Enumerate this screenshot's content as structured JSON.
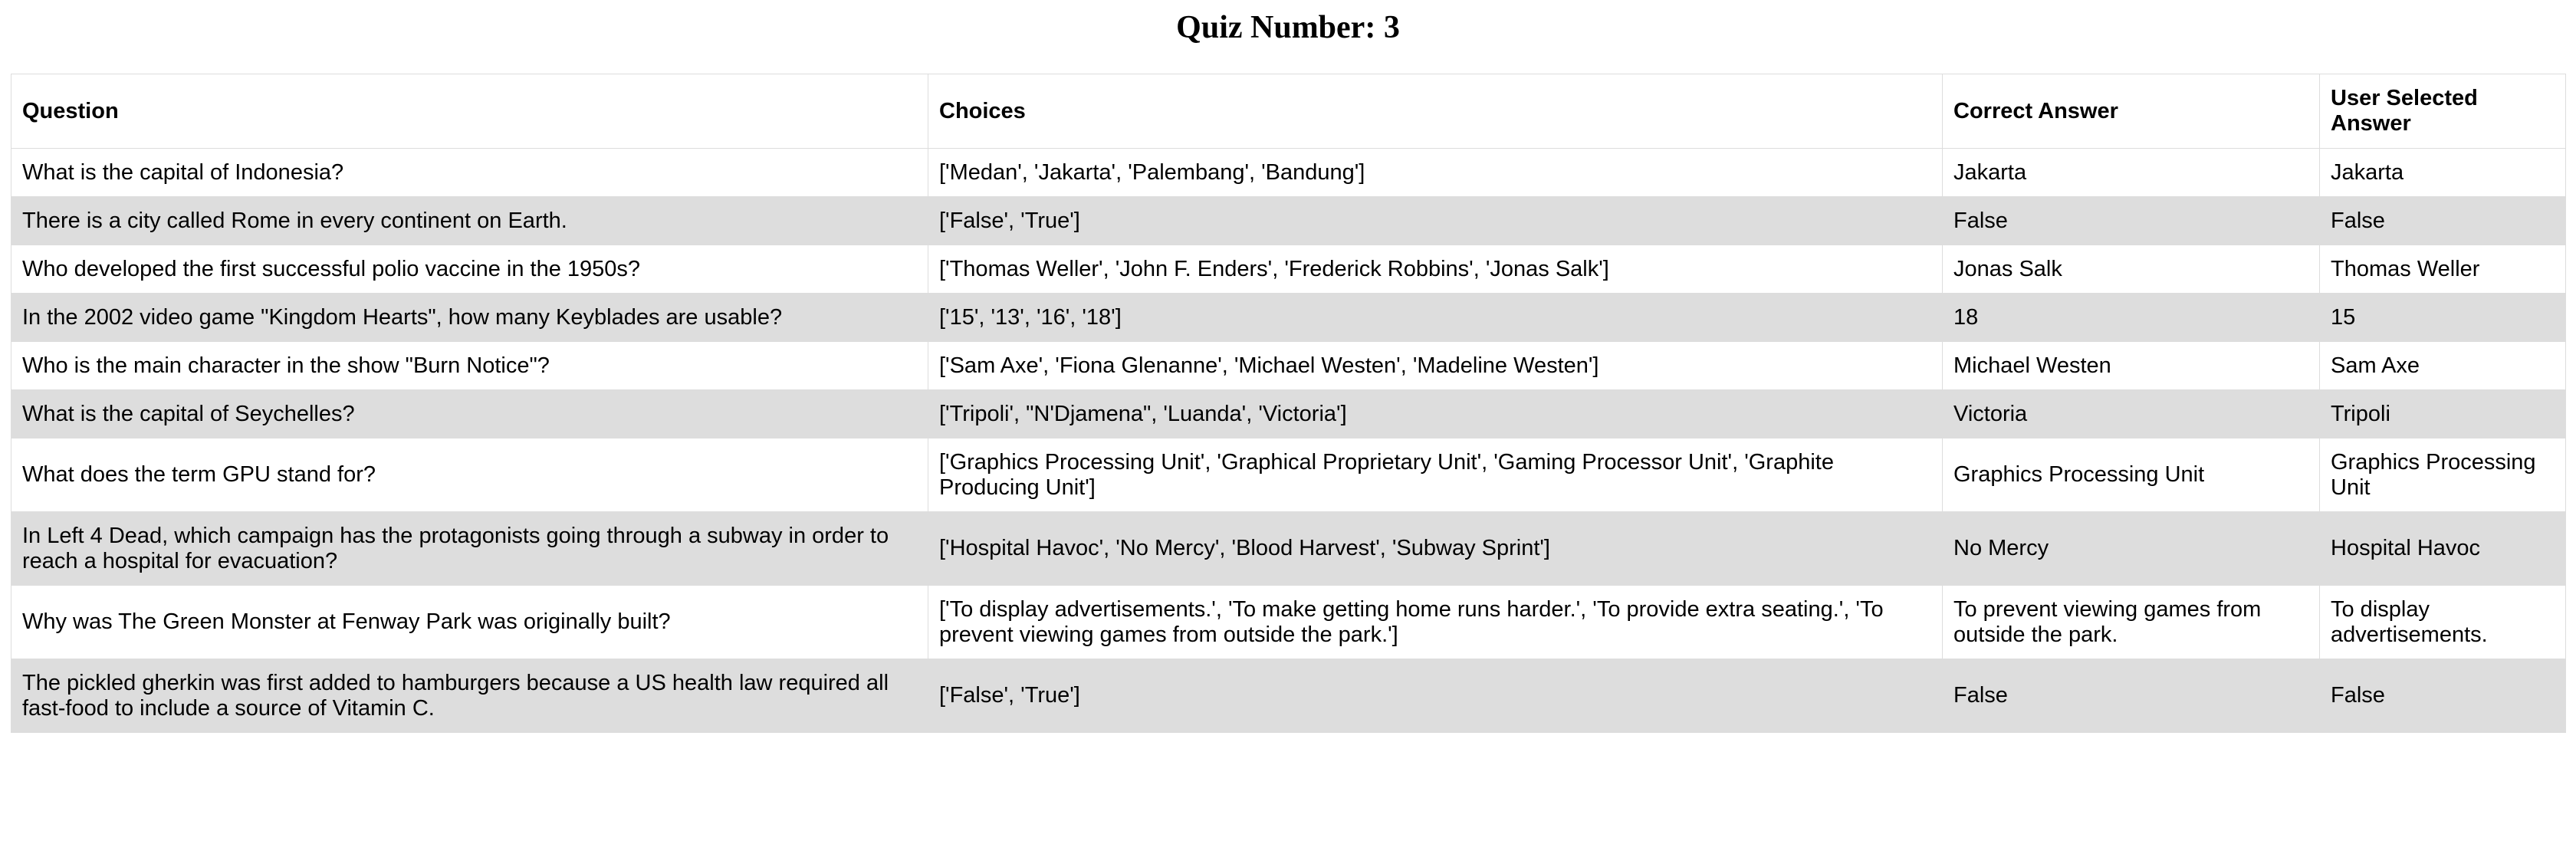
{
  "page": {
    "title": "Quiz Number: 3"
  },
  "table": {
    "headers": {
      "question": "Question",
      "choices": "Choices",
      "correct": "Correct Answer",
      "selected": "User Selected Answer"
    },
    "rows": [
      {
        "question": "What is the capital of Indonesia?",
        "choices": "['Medan', 'Jakarta', 'Palembang', 'Bandung']",
        "correct": "Jakarta",
        "selected": "Jakarta"
      },
      {
        "question": "There is a city called Rome in every continent on Earth.",
        "choices": "['False', 'True']",
        "correct": "False",
        "selected": "False"
      },
      {
        "question": "Who developed the first successful polio vaccine in the 1950s?",
        "choices": "['Thomas Weller', 'John F. Enders', 'Frederick Robbins', 'Jonas Salk']",
        "correct": "Jonas Salk",
        "selected": "Thomas Weller"
      },
      {
        "question": "In the 2002 video game \"Kingdom Hearts\", how many Keyblades are usable?",
        "choices": "['15', '13', '16', '18']",
        "correct": "18",
        "selected": "15"
      },
      {
        "question": "Who is the main character in the show \"Burn Notice\"?",
        "choices": "['Sam Axe', 'Fiona Glenanne', 'Michael Westen', 'Madeline Westen']",
        "correct": "Michael Westen",
        "selected": "Sam Axe"
      },
      {
        "question": "What is the capital of Seychelles?",
        "choices": "['Tripoli', \"N'Djamena\", 'Luanda', 'Victoria']",
        "correct": "Victoria",
        "selected": "Tripoli"
      },
      {
        "question": "What does the term GPU stand for?",
        "choices": "['Graphics Processing Unit', 'Graphical Proprietary Unit', 'Gaming Processor Unit', 'Graphite Producing Unit']",
        "correct": "Graphics Processing Unit",
        "selected": "Graphics Processing Unit"
      },
      {
        "question": "In Left 4 Dead, which campaign has the protagonists going through a subway in order to reach a hospital for evacuation?",
        "choices": "['Hospital Havoc', 'No Mercy', 'Blood Harvest', 'Subway Sprint']",
        "correct": "No Mercy",
        "selected": "Hospital Havoc"
      },
      {
        "question": "Why was The Green Monster at Fenway Park was originally built?",
        "choices": "['To display advertisements.', 'To make getting home runs harder.', 'To provide extra seating.', 'To prevent viewing games from outside the park.']",
        "correct": "To prevent viewing games from outside the park.",
        "selected": "To display advertisements."
      },
      {
        "question": "The pickled gherkin was first added to hamburgers because a US health law required all fast-food to include a source of Vitamin C.",
        "choices": "['False', 'True']",
        "correct": "False",
        "selected": "False"
      }
    ]
  }
}
